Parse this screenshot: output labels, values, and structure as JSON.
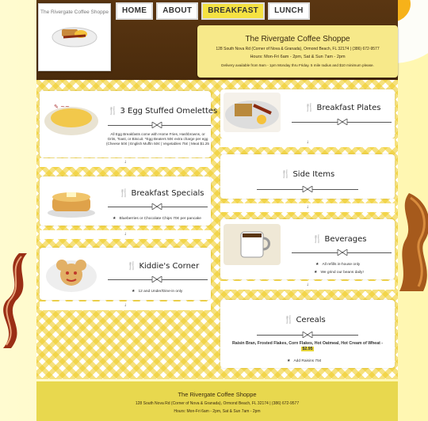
{
  "logo": {
    "text": "The Rivergate Coffee Shoppe"
  },
  "nav": [
    {
      "label": "HOME"
    },
    {
      "label": "ABOUT"
    },
    {
      "label": "BREAKFAST"
    },
    {
      "label": "LUNCH"
    }
  ],
  "info": {
    "title": "The Rivergate Coffee Shoppe",
    "address": "128 South Nova Rd (Corner of Nova & Granada), Ormond Beach, FL 32174 | (386) 672-9577",
    "hours": "Hours: Mon-Fri 6am - 2pm, Sat & Sun 7am - 2pm",
    "delivery": "Delivery available from 9am - 1pm Monday thru Friday. 5 mile radius and $10 minimum please."
  },
  "sections": {
    "omelettes": {
      "title": "3 Egg Stuffed Omelettes",
      "text": "All Egg Breakfasts come with Home Fries, Hashbrowns, or Grits, Toast, or Biscuit. *Egg Beaters 50¢ extra charge per egg (Cheese 50¢ | English Muffin 50¢ | Vegetables 75¢ | Meat $1.25",
      "arrow": "↓"
    },
    "plates": {
      "title": "Breakfast Plates",
      "arrow": "↓"
    },
    "specials": {
      "title": "Breakfast Specials",
      "bullet": "Blueberries or Chocolate Chips 70¢ per pancake",
      "arrow": "↓"
    },
    "sides": {
      "title": "Side Items",
      "arrow": "↓"
    },
    "kiddie": {
      "title": "Kiddie's Corner",
      "bullet": "12 and Under/Dine-in only",
      "arrow": "↓"
    },
    "beverages": {
      "title": "Beverages",
      "bullets": [
        "All refills in-house only",
        "We grind our beans daily!"
      ],
      "arrow": "↓"
    },
    "cereals": {
      "title": "Cereals",
      "text": "Raisin Bran, Frosted Flakes, Corn Flakes, Hot Oatmeal, Hot Cream of Wheat -",
      "price": "$2.95",
      "bullet": "Add Raisins 75¢"
    }
  },
  "footer": {
    "title": "The Rivergate Coffee Shoppe",
    "address": "128 South Nova Rd (Corner of Nova & Granada), Ormond Beach, FL 32174 | (386) 672-9577",
    "hours": "Hours: Mon-Fri 6am - 2pm, Sat & Sun 7am - 2pm"
  },
  "icons": {
    "menu_icon": "fork-knife-icon",
    "divider_icon": "bow-ornament-icon",
    "arrow_icon": "down-arrow-icon",
    "bullet_icon": "star-icon"
  },
  "colors": {
    "header_brown": "#4a2b0c",
    "accent_yellow": "#f5e242",
    "check_yellow": "#f0cd28",
    "footer_yellow": "#e8d84e"
  }
}
